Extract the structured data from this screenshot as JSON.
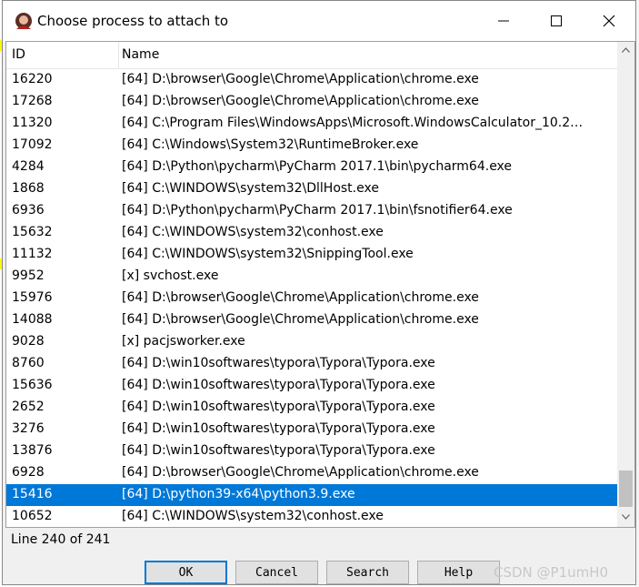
{
  "dialog": {
    "title": "Choose process to attach to",
    "window_buttons": {
      "minimize_icon": "minimize-icon",
      "maximize_icon": "maximize-icon",
      "close_icon": "close-icon"
    }
  },
  "list": {
    "columns": [
      "ID",
      "Name"
    ],
    "rows": [
      {
        "id": "16220",
        "name": "[64] D:\\browser\\Google\\Chrome\\Application\\chrome.exe"
      },
      {
        "id": "17268",
        "name": "[64] D:\\browser\\Google\\Chrome\\Application\\chrome.exe"
      },
      {
        "id": "11320",
        "name": "[64] C:\\Program Files\\WindowsApps\\Microsoft.WindowsCalculator_10.2…"
      },
      {
        "id": "17092",
        "name": "[64] C:\\Windows\\System32\\RuntimeBroker.exe"
      },
      {
        "id": "4284",
        "name": "[64] D:\\Python\\pycharm\\PyCharm 2017.1\\bin\\pycharm64.exe"
      },
      {
        "id": "1868",
        "name": "[64] C:\\WINDOWS\\system32\\DllHost.exe"
      },
      {
        "id": "6936",
        "name": "[64] D:\\Python\\pycharm\\PyCharm 2017.1\\bin\\fsnotifier64.exe"
      },
      {
        "id": "15632",
        "name": "[64] C:\\WINDOWS\\system32\\conhost.exe"
      },
      {
        "id": "11132",
        "name": "[64] C:\\WINDOWS\\system32\\SnippingTool.exe"
      },
      {
        "id": "9952",
        "name": "[x] svchost.exe"
      },
      {
        "id": "15976",
        "name": "[64] D:\\browser\\Google\\Chrome\\Application\\chrome.exe"
      },
      {
        "id": "14088",
        "name": "[64] D:\\browser\\Google\\Chrome\\Application\\chrome.exe"
      },
      {
        "id": "9028",
        "name": "[x] pacjsworker.exe"
      },
      {
        "id": "8760",
        "name": "[64] D:\\win10softwares\\typora\\Typora\\Typora.exe"
      },
      {
        "id": "15636",
        "name": "[64] D:\\win10softwares\\typora\\Typora\\Typora.exe"
      },
      {
        "id": "2652",
        "name": "[64] D:\\win10softwares\\typora\\Typora\\Typora.exe"
      },
      {
        "id": "3276",
        "name": "[64] D:\\win10softwares\\typora\\Typora\\Typora.exe"
      },
      {
        "id": "13876",
        "name": "[64] D:\\win10softwares\\typora\\Typora\\Typora.exe"
      },
      {
        "id": "6928",
        "name": "[64] D:\\browser\\Google\\Chrome\\Application\\chrome.exe"
      },
      {
        "id": "15416",
        "name": "[64] D:\\python39-x64\\python3.9.exe",
        "selected": true
      },
      {
        "id": "10652",
        "name": "[64] C:\\WINDOWS\\system32\\conhost.exe"
      }
    ],
    "selection_color": "#0078d7"
  },
  "status": {
    "text": "Line 240 of 241"
  },
  "buttons": {
    "ok": "OK",
    "cancel": "Cancel",
    "search": "Search",
    "help": "Help"
  },
  "watermark": "CSDN @P1umH0"
}
